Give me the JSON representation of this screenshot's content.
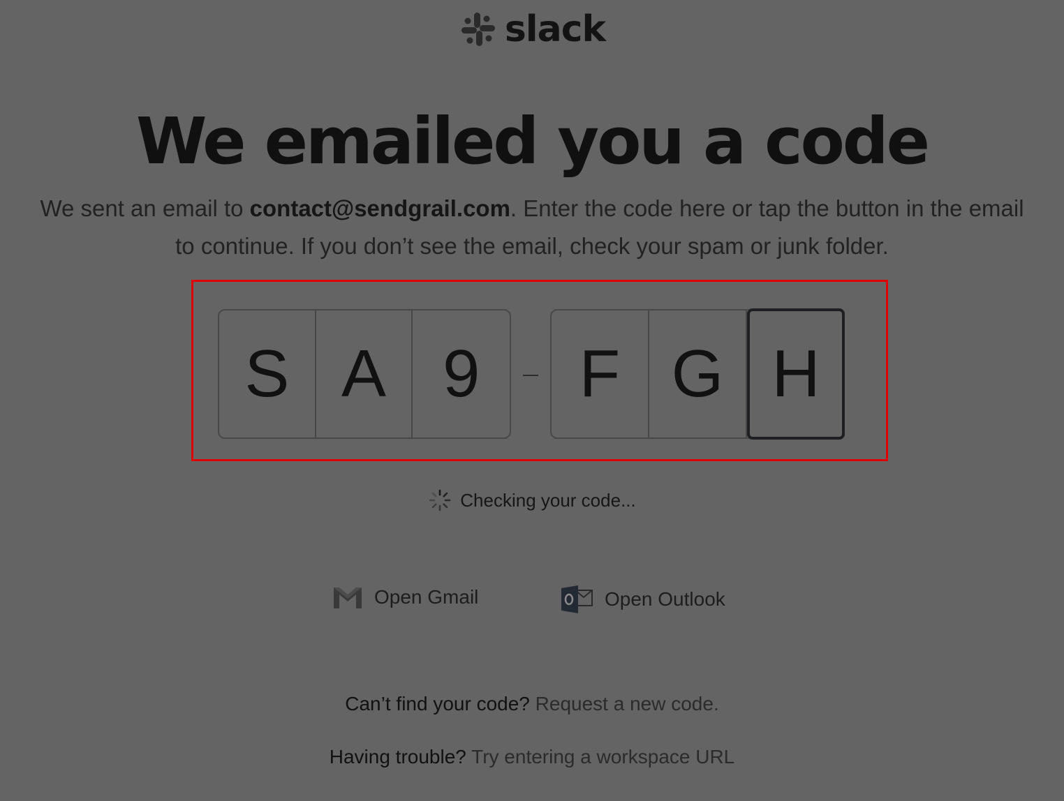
{
  "brand": {
    "name": "slack"
  },
  "page": {
    "title": "We emailed you a code",
    "subtitle_prefix": "We sent an email to ",
    "email": "contact@sendgrail.com",
    "subtitle_suffix": ". Enter the code here or tap the button in the email to continue. If you don’t see the email, check your spam or junk folder."
  },
  "code": {
    "group1": [
      "S",
      "A",
      "9"
    ],
    "group2": [
      "F",
      "G",
      "H"
    ],
    "active_index": 5
  },
  "status": {
    "text": "Checking your code..."
  },
  "links": {
    "gmail_label": "Open Gmail",
    "outlook_label": "Open Outlook"
  },
  "help": {
    "cant_find_prefix": "Can’t find your code?",
    "cant_find_link": "Request a new code.",
    "trouble_prefix": "Having trouble?",
    "trouble_link": "Try entering a workspace URL"
  },
  "colors": {
    "overlay_background": "#646464",
    "highlight_border": "#e00000"
  }
}
